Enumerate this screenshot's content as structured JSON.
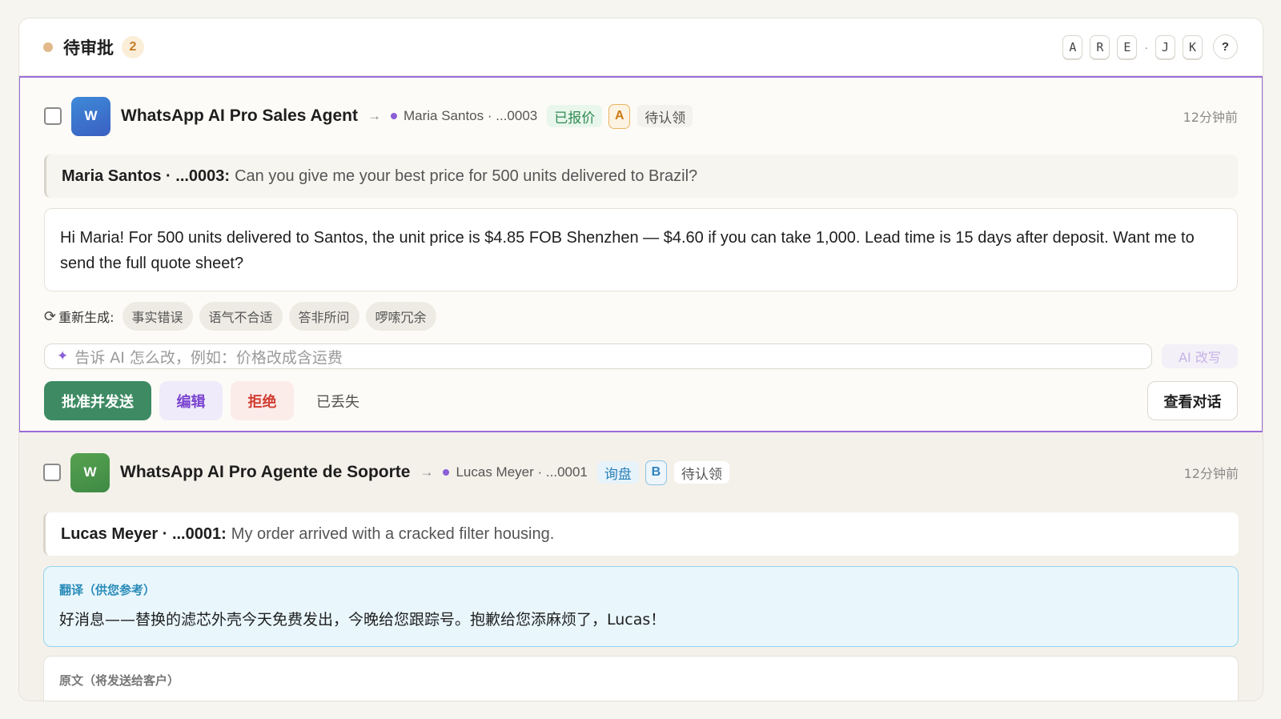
{
  "header": {
    "title": "待审批",
    "count": "2",
    "shortcuts": [
      "A",
      "R",
      "E",
      "J",
      "K"
    ],
    "separator": "·",
    "help": "?"
  },
  "cards": [
    {
      "avatar": "W",
      "agent": "WhatsApp AI Pro Sales Agent",
      "arrow": "→",
      "contact": "Maria Santos · ...0003",
      "stage": "已报价",
      "grade": "A",
      "claim": "待认领",
      "time": "12分钟前",
      "quote_sender": "Maria Santos · ...0003:",
      "quote_text": "Can you give me your best price for 500 units delivered to Brazil?",
      "reply": "Hi Maria! For 500 units delivered to Santos, the unit price is $4.85 FOB Shenzhen — $4.60 if you can take 1,000. Lead time is 15 days after deposit. Want me to send the full quote sheet?",
      "regen_label": "重新生成:",
      "regen_chips": [
        "事实错误",
        "语气不合适",
        "答非所问",
        "啰嗦冗余"
      ],
      "ai_placeholder": "告诉 AI 怎么改，例如：价格改成含运费",
      "ai_rewrite": "AI 改写",
      "actions": {
        "approve": "批准并发送",
        "edit": "编辑",
        "reject": "拒绝",
        "lost": "已丢失",
        "view": "查看对话"
      }
    },
    {
      "avatar": "W",
      "agent": "WhatsApp AI Pro Agente de Soporte",
      "arrow": "→",
      "contact": "Lucas Meyer · ...0001",
      "stage": "询盘",
      "grade": "B",
      "claim": "待认领",
      "time": "12分钟前",
      "quote_sender": "Lucas Meyer · ...0001:",
      "quote_text": "My order arrived with a cracked filter housing.",
      "translation_label": "翻译（供您参考）",
      "translation_text": "好消息——替换的滤芯外壳今天免费发出，今晚给您跟踪号。抱歉给您添麻烦了，Lucas！",
      "original_label": "原文（将发送给客户）"
    }
  ],
  "colors": {
    "selected_border": "#9a6bd8",
    "approve": "#3d8a63",
    "pending_dot": "#e2b98a"
  }
}
